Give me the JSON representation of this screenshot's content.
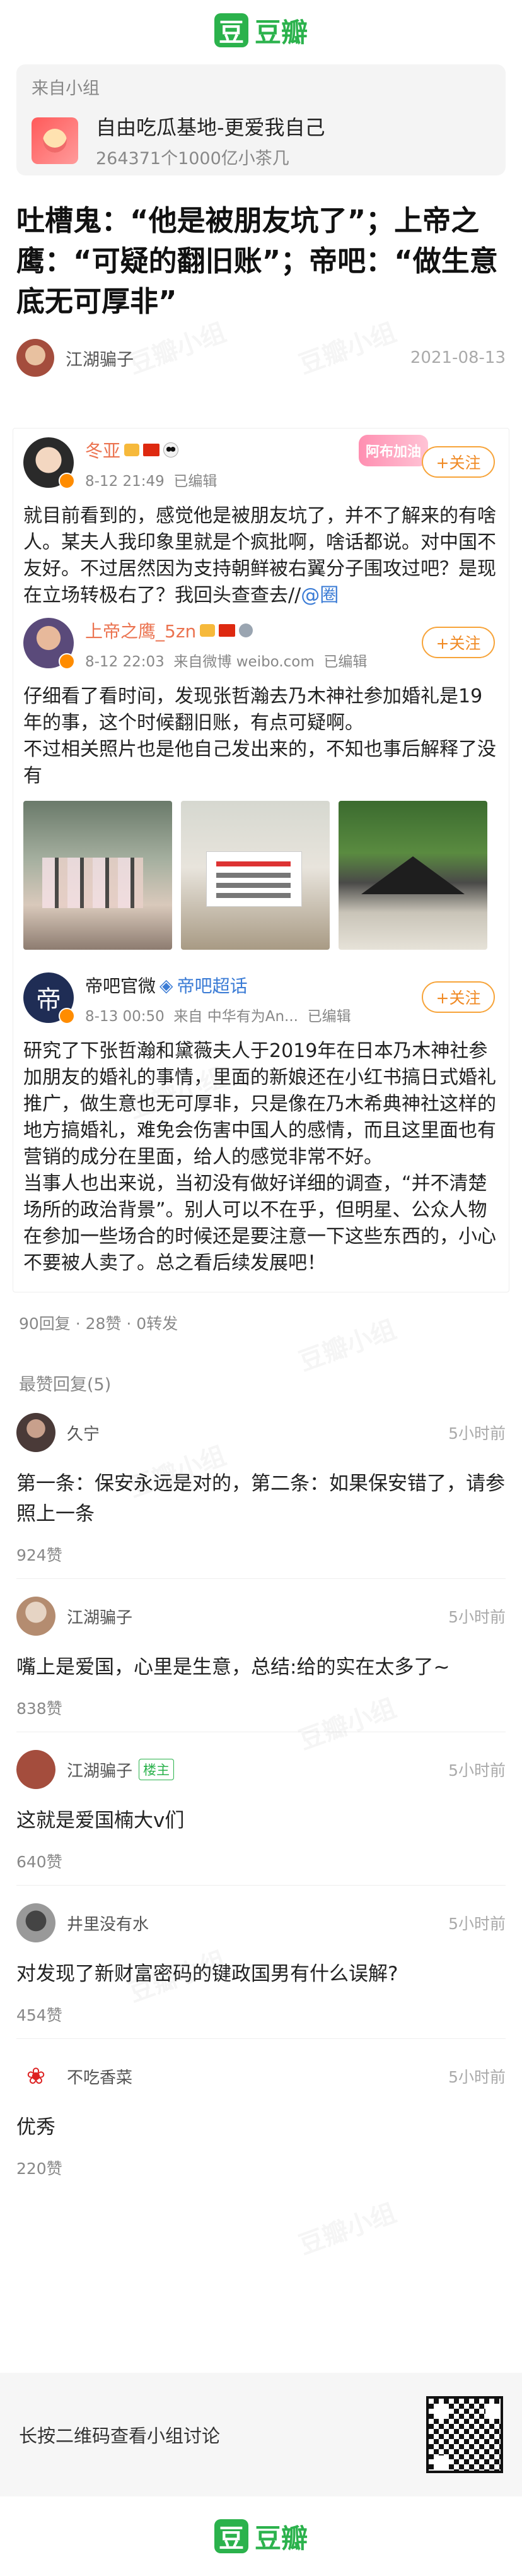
{
  "brand": {
    "logo_char": "豆",
    "name": "豆瓣",
    "color": "#2bb24c"
  },
  "group": {
    "from_label": "来自小组",
    "name": "自由吃瓜基地-更爱我自己",
    "meta": "264371个1000亿小茶几"
  },
  "post": {
    "title": "吐槽鬼：“他是被朋友坑了”；上帝之鹰：“可疑的翻旧账”；帝吧：“做生意底无可厚非”",
    "author": "江湖骗子",
    "date": "2021-08-13"
  },
  "weibo": {
    "banner": "阿布加油",
    "follow_label": "+关注",
    "posts": [
      {
        "name": "冬亚",
        "meta_time": "8-12 21:49",
        "meta_edit": "已编辑",
        "paragraphs": [
          "就目前看到的，感觉他是被朋友坑了，并不了解来的有啥人。某夫人我印象里就是个疯批啊，啥话都说。对中国不友好。不过居然因为支持朝鲜被右翼分子围攻过吧？是现在立场转极右了？我回头查查去//"
        ],
        "mention": "@圈"
      },
      {
        "name": "上帝之鹰_5zn",
        "meta_time": "8-12 22:03",
        "meta_source": "来自微博 weibo.com",
        "meta_edit": "已编辑",
        "paragraphs": [
          "仔细看了看时间，发现张哲瀚去乃木神社参加婚礼是19年的事，这个时候翻旧账，有点可疑啊。",
          "不过相关照片也是他自己发出来的，不知也事后解释了没有"
        ]
      },
      {
        "name": "帝吧官微",
        "super_tag": "帝吧超话",
        "meta_time": "8-13 00:50",
        "meta_source": "来自 中华有为An...",
        "meta_edit": "已编辑",
        "avatar_char": "帝",
        "paragraphs": [
          "研究了下张哲瀚和黛薇夫人于2019年在日本乃木神社参加朋友的婚礼的事情，里面的新娘还在小红书搞日式婚礼推广，做生意也无可厚非，只是像在乃木希典神社这样的地方搞婚礼，难免会伤害中国人的感情，而且这里面也有营销的成分在里面，给人的感觉非常不好。",
          "当事人也出来说，当初没有做好详细的调查，“并不清楚场所的政治背景”。别人可以不在乎，但明星、公众人物在参加一些场合的时候还是要注意一下这些东西的，小心不要被人卖了。总之看后续发展吧！"
        ]
      }
    ],
    "stats": "90回复 · 28赞 · 0转发"
  },
  "comments": {
    "section_title": "最赞回复(5)",
    "owner_tag": "楼主",
    "items": [
      {
        "name": "久宁",
        "time": "5小时前",
        "text": "第一条：保安永远是对的，第二条：如果保安错了，请参照上一条",
        "likes": "924赞"
      },
      {
        "name": "江湖骗子",
        "time": "5小时前",
        "text": "嘴上是爱国，心里是生意，总结:给的实在太多了~",
        "likes": "838赞"
      },
      {
        "name": "江湖骗子",
        "time": "5小时前",
        "text": "这就是爱国楠大v们",
        "likes": "640赞",
        "owner": true
      },
      {
        "name": "井里没有水",
        "time": "5小时前",
        "text": "对发现了新财富密码的键政国男有什么误解?",
        "likes": "454赞"
      },
      {
        "name": "不吃香菜",
        "time": "5小时前",
        "text": "优秀",
        "likes": "220赞"
      }
    ]
  },
  "qr_section": {
    "text": "长按二维码查看小组讨论"
  },
  "watermark_text": "豆瓣小组"
}
